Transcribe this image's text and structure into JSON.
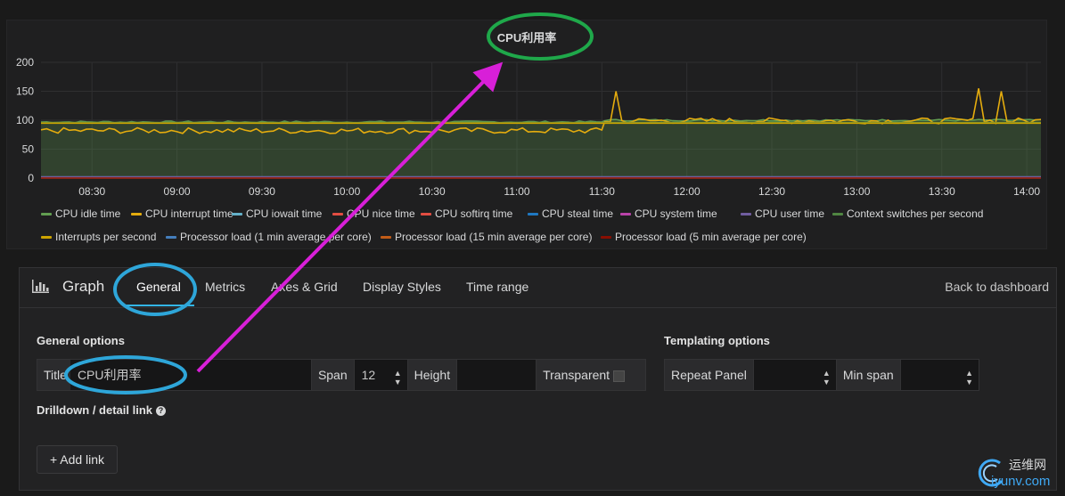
{
  "panel": {
    "title": "CPU利用率",
    "legend_rows": [
      [
        "CPU idle time",
        "CPU interrupt time",
        "CPU iowait time",
        "CPU nice time",
        "CPU softirq time",
        "CPU steal time",
        "CPU system time",
        "CPU user time",
        "Context switches per second"
      ],
      [
        "Interrupts per second",
        "Processor load (1 min average per core)",
        "Processor load (15 min average per core)",
        "Processor load (5 min average per core)"
      ]
    ]
  },
  "chart_data": {
    "type": "line",
    "title": "CPU利用率",
    "x_ticks": [
      "08:30",
      "09:00",
      "09:30",
      "10:00",
      "10:30",
      "11:00",
      "11:30",
      "12:00",
      "12:30",
      "13:00",
      "13:30",
      "14:00"
    ],
    "y_ticks": [
      "0",
      "50",
      "100",
      "150",
      "200"
    ],
    "ylim": [
      0,
      200
    ],
    "x_range": [
      "08:12",
      "14:05"
    ],
    "grid": true,
    "legend_placement": "bottom",
    "series": [
      {
        "name": "CPU idle time",
        "color": "#629e51",
        "fill": true,
        "segments": [
          {
            "from": "08:12",
            "to": "11:31",
            "mean": 97
          },
          {
            "from": "11:31",
            "to": "14:05",
            "mean": 100
          }
        ]
      },
      {
        "name": "CPU interrupt time",
        "color": "#e5ac0e",
        "segments": [
          {
            "from": "08:12",
            "to": "11:31",
            "mean": 82
          },
          {
            "from": "11:31",
            "to": "14:05",
            "mean": 99
          }
        ],
        "spikes": [
          {
            "x": "11:35",
            "y": 150
          },
          {
            "x": "13:44",
            "y": 155
          },
          {
            "x": "13:50",
            "y": 150
          }
        ]
      },
      {
        "name": "CPU iowait time",
        "color": "#64b0c8",
        "value": 2
      },
      {
        "name": "CPU nice time",
        "color": "#e24d42",
        "value": 1
      },
      {
        "name": "CPU softirq time",
        "color": "#e24d42",
        "value": 1
      },
      {
        "name": "CPU steal time",
        "color": "#1f78c1",
        "value": 0
      },
      {
        "name": "CPU system time",
        "color": "#ba43a9",
        "value": 1
      },
      {
        "name": "CPU user time",
        "color": "#705da0",
        "value": 2
      },
      {
        "name": "Context switches per second",
        "color": "#508642",
        "value": 96
      },
      {
        "name": "Interrupts per second",
        "color": "#cca300",
        "value": 95
      },
      {
        "name": "Processor load (1 min average per core)",
        "color": "#447ebc",
        "value": 0
      },
      {
        "name": "Processor load (15 min average per core)",
        "color": "#c15c17",
        "value": 0
      },
      {
        "name": "Processor load (5 min average per core)",
        "color": "#890f02",
        "value": 0
      }
    ]
  },
  "editor": {
    "panel_type": "Graph",
    "tabs": [
      "General",
      "Metrics",
      "Axes & Grid",
      "Display Styles",
      "Time range"
    ],
    "active_tab": "General",
    "back_label": "Back to dashboard",
    "general_options_title": "General options",
    "title_label": "Title",
    "title_value": "CPU利用率",
    "span_label": "Span",
    "span_value": "12",
    "height_label": "Height",
    "height_value": "",
    "transparent_label": "Transparent",
    "templating_title": "Templating options",
    "repeat_panel_label": "Repeat Panel",
    "repeat_panel_value": "",
    "min_span_label": "Min span",
    "min_span_value": "",
    "drilldown_title": "Drilldown / detail link",
    "help_glyph": "?",
    "add_link_label": "+ Add link"
  },
  "watermark": {
    "cn": "运维网",
    "en": "iyunv.com"
  },
  "colors": {
    "accent": "#33b5e5",
    "annotation_green": "#1fa84a",
    "annotation_blue": "#2ea6d9",
    "annotation_arrow": "#d81fd8"
  }
}
